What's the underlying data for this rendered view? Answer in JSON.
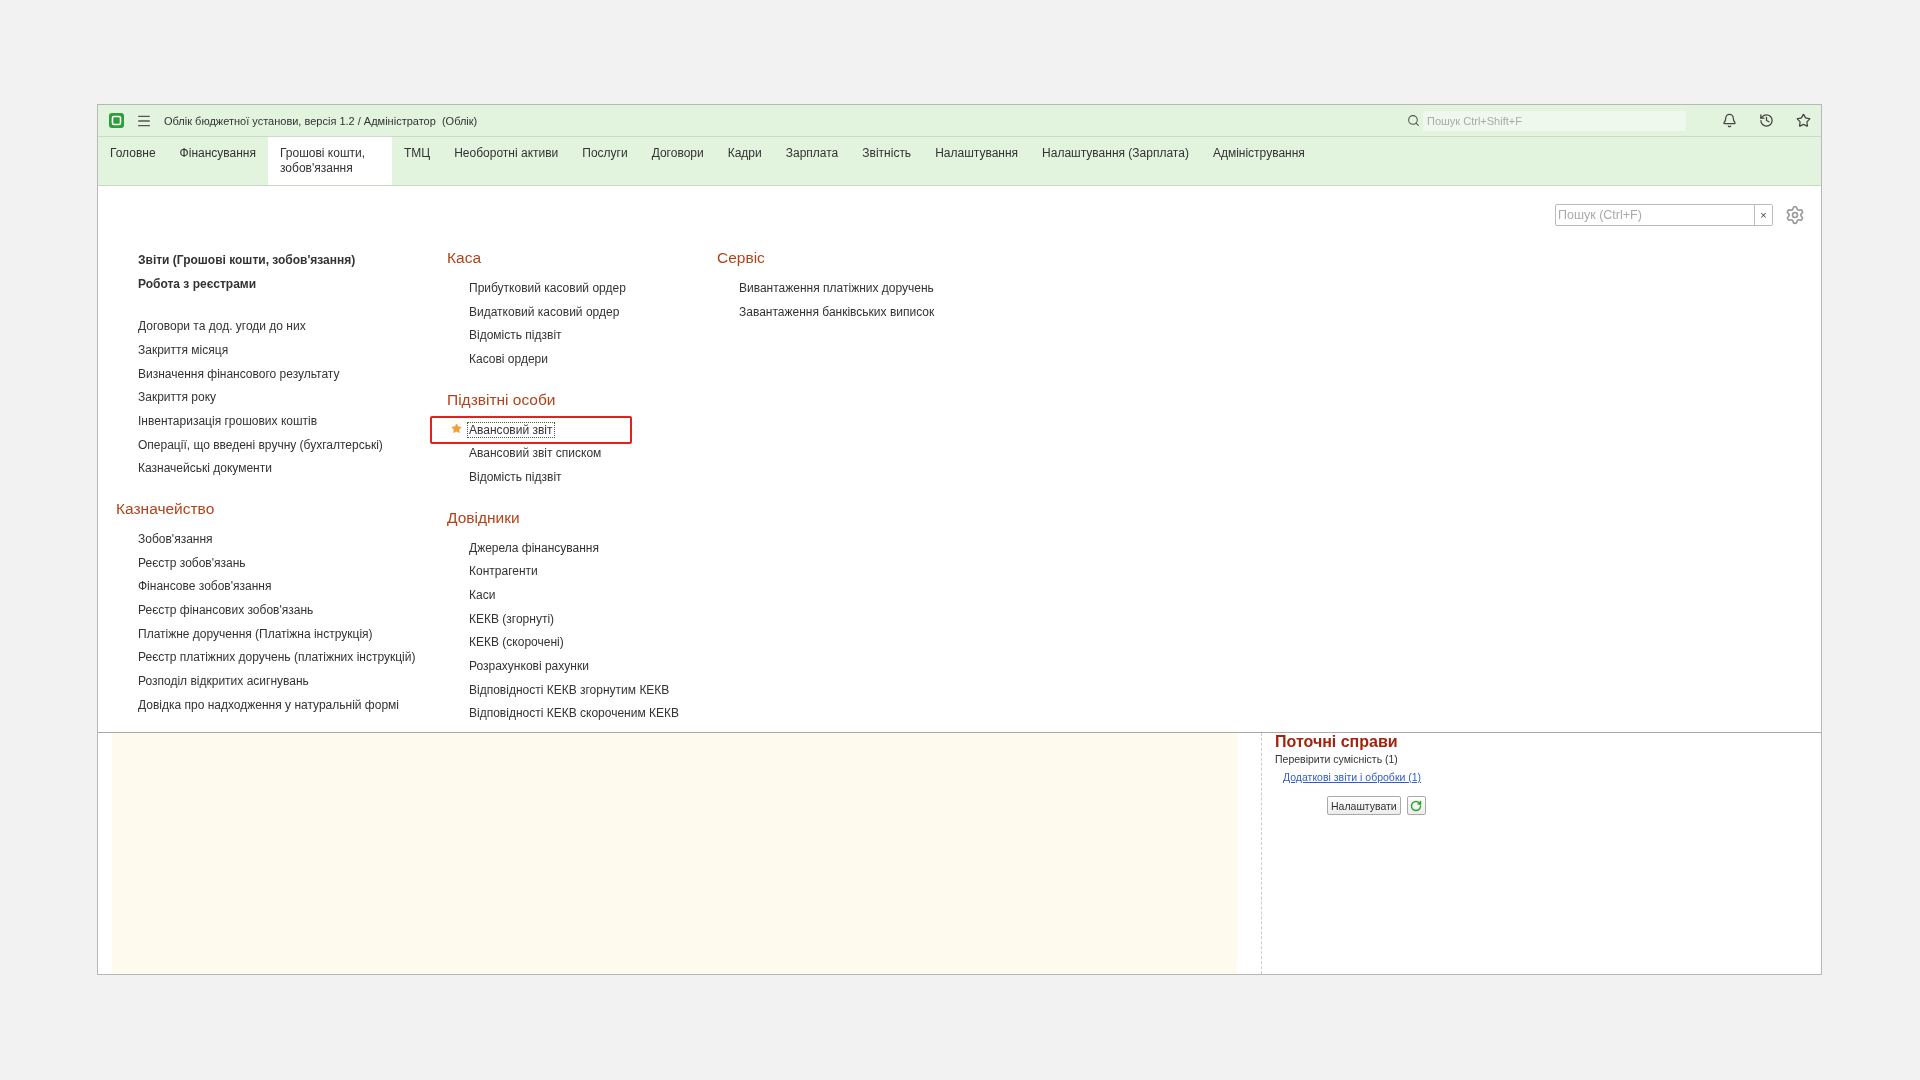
{
  "window": {
    "title": "Облік бюджетної установи, версія 1.2 / Адміністратор  (Облік)"
  },
  "global_search": {
    "placeholder": "Пошук Ctrl+Shift+F"
  },
  "sections": [
    {
      "label": "Головне",
      "selected": false
    },
    {
      "label": "Фінансування",
      "selected": false
    },
    {
      "label": "Грошові кошти, зобов'язання",
      "selected": true
    },
    {
      "label": "ТМЦ",
      "selected": false
    },
    {
      "label": "Необоротні активи",
      "selected": false
    },
    {
      "label": "Послуги",
      "selected": false
    },
    {
      "label": "Договори",
      "selected": false
    },
    {
      "label": "Кадри",
      "selected": false
    },
    {
      "label": "Зарплата",
      "selected": false
    },
    {
      "label": "Звітність",
      "selected": false
    },
    {
      "label": "Налаштування",
      "selected": false
    },
    {
      "label": "Налаштування (Зарплата)",
      "selected": false
    },
    {
      "label": "Адміністрування",
      "selected": false
    }
  ],
  "panel_search": {
    "placeholder": "Пошук (Ctrl+F)",
    "clear": "×"
  },
  "columns": [
    {
      "groups": [
        {
          "kind": "reports",
          "items": [
            {
              "label": "Звіти (Грошові кошти, зобов'язання)",
              "selected": false,
              "starred": false
            },
            {
              "label": "Робота з реєстрами",
              "selected": false,
              "starred": false
            }
          ]
        },
        {
          "kind": "list",
          "items": [
            {
              "label": "Договори та дод. угоди до них",
              "selected": false,
              "starred": false
            },
            {
              "label": "Закриття місяця",
              "selected": false,
              "starred": false
            },
            {
              "label": "Визначення фінансового результату",
              "selected": false,
              "starred": false
            },
            {
              "label": "Закриття року",
              "selected": false,
              "starred": false
            },
            {
              "label": "Інвентаризація грошових коштів",
              "selected": false,
              "starred": false
            },
            {
              "label": "Операції, що введені вручну (бухгалтерські)",
              "selected": false,
              "starred": false
            },
            {
              "label": "Казначейські документи",
              "selected": false,
              "starred": false
            }
          ]
        },
        {
          "kind": "list",
          "title": "Казначейство",
          "items": [
            {
              "label": "Зобов'язання",
              "selected": false,
              "starred": false
            },
            {
              "label": "Реєстр зобов'язань",
              "selected": false,
              "starred": false
            },
            {
              "label": "Фінансове зобов'язання",
              "selected": false,
              "starred": false
            },
            {
              "label": "Реєстр фінансових зобов'язань",
              "selected": false,
              "starred": false
            },
            {
              "label": "Платіжне доручення (Платіжна інструкція)",
              "selected": false,
              "starred": false
            },
            {
              "label": "Реєстр платіжних доручень (платіжних інструкцій)",
              "selected": false,
              "starred": false
            },
            {
              "label": "Розподіл відкритих асигнувань",
              "selected": false,
              "starred": false
            },
            {
              "label": "Довідка про надходження у натуральній формі",
              "selected": false,
              "starred": false
            }
          ]
        }
      ]
    },
    {
      "groups": [
        {
          "kind": "list",
          "title": "Каса",
          "items": [
            {
              "label": "Прибутковий касовий ордер",
              "selected": false,
              "starred": false
            },
            {
              "label": "Видатковий касовий ордер",
              "selected": false,
              "starred": false
            },
            {
              "label": "Відомість підзвіт",
              "selected": false,
              "starred": false
            },
            {
              "label": "Касові ордери",
              "selected": false,
              "starred": false
            }
          ]
        },
        {
          "kind": "list",
          "title": "Підзвітні особи",
          "items": [
            {
              "label": "Авансовий звіт",
              "selected": true,
              "starred": true
            },
            {
              "label": "Авансовий звіт списком",
              "selected": false,
              "starred": false
            },
            {
              "label": "Відомість підзвіт",
              "selected": false,
              "starred": false
            }
          ]
        },
        {
          "kind": "list",
          "title": "Довідники",
          "items": [
            {
              "label": "Джерела фінансування",
              "selected": false,
              "starred": false
            },
            {
              "label": "Контрагенти",
              "selected": false,
              "starred": false
            },
            {
              "label": "Каси",
              "selected": false,
              "starred": false
            },
            {
              "label": "КЕКВ (згорнуті)",
              "selected": false,
              "starred": false
            },
            {
              "label": "КЕКВ (скорочені)",
              "selected": false,
              "starred": false
            },
            {
              "label": "Розрахункові рахунки",
              "selected": false,
              "starred": false
            },
            {
              "label": "Відповідності КЕКВ згорнутим КЕКВ",
              "selected": false,
              "starred": false
            },
            {
              "label": "Відповідності КЕКВ скороченим КЕКВ",
              "selected": false,
              "starred": false
            }
          ]
        }
      ]
    },
    {
      "groups": [
        {
          "kind": "list",
          "title": "Сервіс",
          "items": [
            {
              "label": "Вивантаження платіжних доручень",
              "selected": false,
              "starred": false
            },
            {
              "label": "Завантаження банківських виписок",
              "selected": false,
              "starred": false
            }
          ]
        }
      ]
    }
  ],
  "current_tasks": {
    "title": "Поточні справи",
    "items": [
      {
        "kind": "text",
        "label": "Перевірити сумісність (1)"
      },
      {
        "kind": "link",
        "label": "Додаткові звіти і обробки (1)"
      }
    ],
    "settings_button": "Налаштувати"
  }
}
